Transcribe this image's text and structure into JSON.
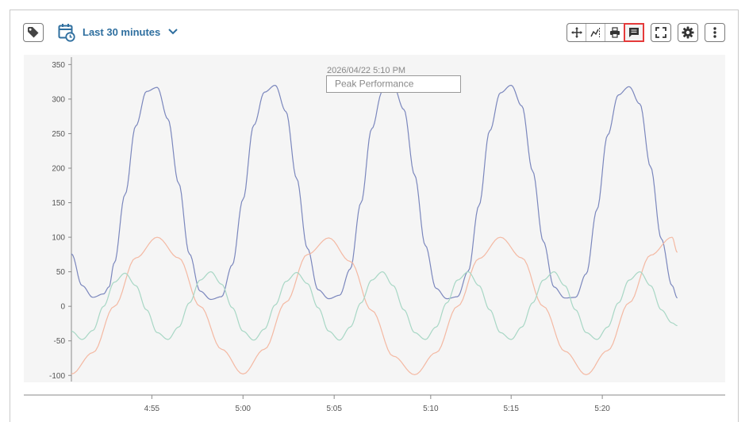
{
  "toolbar": {
    "time_range_label": "Last 30 minutes",
    "icons": {
      "tag": "tag-icon",
      "time": "calendar-clock-icon",
      "chevron": "chevron-down-icon",
      "pan": "pan-icon",
      "select": "select-zoom-icon",
      "print": "print-icon",
      "annotation": "annotation-icon",
      "fullscreen": "fullscreen-icon",
      "settings": "gear-icon",
      "more": "more-vertical-icon"
    },
    "active_tool": "annotation"
  },
  "annotation": {
    "timestamp": "2026/04/22 5:10 PM",
    "text": "Peak Performance",
    "x": 5.175,
    "y": 320
  },
  "chart_data": {
    "type": "line",
    "title": "",
    "xlabel": "",
    "ylabel": "",
    "x_ticks": [
      {
        "v": 4.915,
        "label": "4:55"
      },
      {
        "v": 5.0,
        "label": "5:00"
      },
      {
        "v": 5.085,
        "label": "5:05"
      },
      {
        "v": 5.175,
        "label": "5:10"
      },
      {
        "v": 5.25,
        "label": "5:15"
      },
      {
        "v": 5.335,
        "label": "5:20"
      }
    ],
    "xlim": [
      4.84,
      5.42
    ],
    "ylim": [
      -102,
      355
    ],
    "y_ticks": [
      -100,
      -50,
      0,
      50,
      100,
      150,
      200,
      250,
      300,
      350
    ],
    "grid": false,
    "legend": "none",
    "series": [
      {
        "color": "#7b87bd",
        "x": [
          4.84,
          4.85,
          4.86,
          4.87,
          4.875,
          4.88,
          4.89,
          4.9,
          4.91,
          4.92,
          4.93,
          4.94,
          4.95,
          4.96,
          4.97,
          4.98,
          4.99,
          5.0,
          5.01,
          5.02,
          5.03,
          5.04,
          5.05,
          5.06,
          5.07,
          5.08,
          5.09,
          5.1,
          5.11,
          5.12,
          5.13,
          5.14,
          5.15,
          5.16,
          5.17,
          5.18,
          5.19,
          5.2,
          5.21,
          5.22,
          5.23,
          5.24,
          5.25,
          5.26,
          5.27,
          5.28,
          5.29,
          5.3,
          5.31,
          5.32,
          5.33,
          5.34,
          5.35,
          5.36,
          5.37,
          5.38,
          5.39,
          5.4,
          5.405
        ],
        "y": [
          76,
          30,
          13,
          18,
          28,
          63,
          162,
          261,
          311,
          317,
          271,
          178,
          76,
          22,
          10,
          14,
          60,
          155,
          262,
          310,
          320,
          282,
          185,
          84,
          24,
          11,
          16,
          54,
          150,
          257,
          311,
          320,
          285,
          190,
          88,
          26,
          11,
          14,
          51,
          146,
          254,
          309,
          320,
          290,
          196,
          94,
          28,
          12,
          13,
          47,
          140,
          248,
          306,
          318,
          293,
          202,
          98,
          30,
          12
        ]
      },
      {
        "color": "#f4b9a3",
        "x": [
          4.84,
          4.86,
          4.88,
          4.9,
          4.92,
          4.94,
          4.96,
          4.98,
          5.0,
          5.02,
          5.04,
          5.06,
          5.08,
          5.1,
          5.12,
          5.14,
          5.16,
          5.18,
          5.2,
          5.22,
          5.24,
          5.26,
          5.28,
          5.3,
          5.32,
          5.34,
          5.36,
          5.38,
          5.4,
          5.405
        ],
        "y": [
          -98,
          -67,
          0,
          70,
          100,
          70,
          0,
          -62,
          -98,
          -62,
          6,
          75,
          99,
          65,
          -6,
          -72,
          -99,
          -67,
          0,
          69,
          100,
          70,
          0,
          -65,
          -99,
          -64,
          5,
          74,
          100,
          78
        ]
      },
      {
        "color": "#a8d7c5",
        "x": [
          4.84,
          4.85,
          4.86,
          4.87,
          4.88,
          4.89,
          4.9,
          4.91,
          4.92,
          4.93,
          4.94,
          4.95,
          4.96,
          4.97,
          4.98,
          4.99,
          5.0,
          5.01,
          5.02,
          5.03,
          5.04,
          5.05,
          5.06,
          5.07,
          5.08,
          5.09,
          5.1,
          5.11,
          5.12,
          5.13,
          5.14,
          5.15,
          5.16,
          5.17,
          5.18,
          5.19,
          5.2,
          5.21,
          5.22,
          5.23,
          5.24,
          5.25,
          5.26,
          5.27,
          5.28,
          5.29,
          5.3,
          5.31,
          5.32,
          5.33,
          5.34,
          5.35,
          5.36,
          5.37,
          5.38,
          5.39,
          5.4,
          5.405
        ],
        "y": [
          -36,
          -48,
          -35,
          0,
          35,
          48,
          30,
          -5,
          -38,
          -48,
          -30,
          5,
          38,
          50,
          32,
          -2,
          -36,
          -49,
          -33,
          2,
          36,
          49,
          33,
          -2,
          -36,
          -49,
          -30,
          5,
          38,
          50,
          30,
          -5,
          -38,
          -48,
          -30,
          5,
          38,
          50,
          30,
          -5,
          -38,
          -48,
          -30,
          5,
          38,
          50,
          30,
          -5,
          -38,
          -48,
          -30,
          5,
          38,
          50,
          30,
          -5,
          -24,
          -28
        ]
      }
    ]
  }
}
